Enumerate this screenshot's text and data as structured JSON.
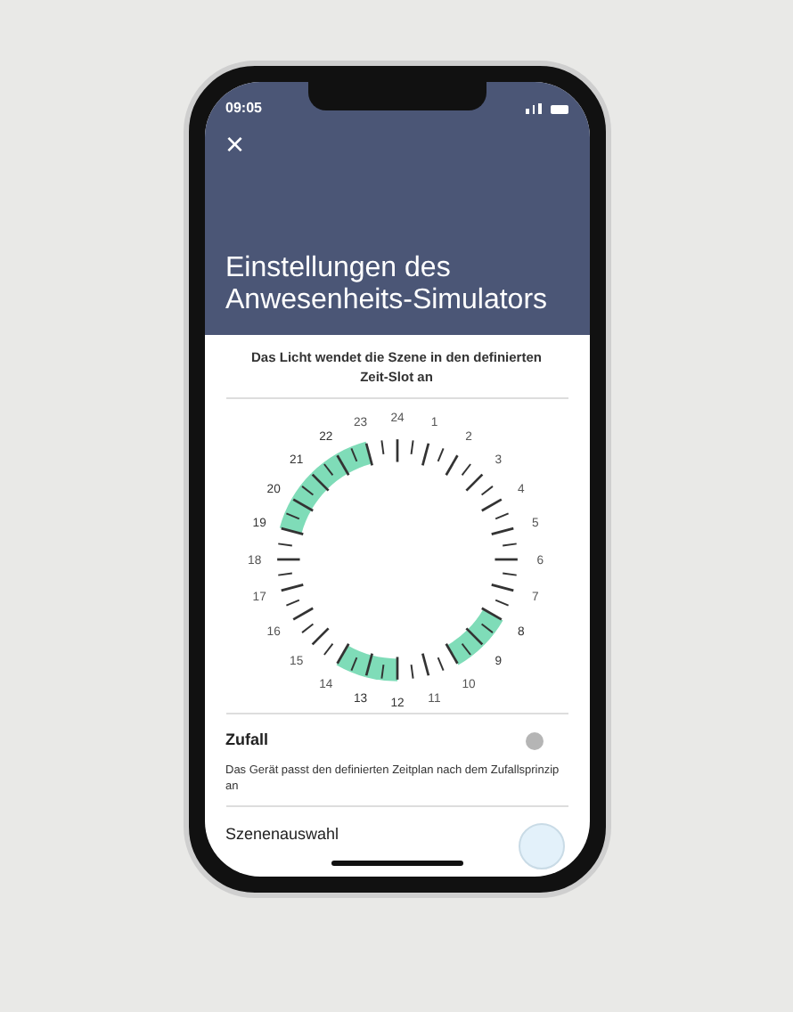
{
  "status_bar": {
    "time": "09:05"
  },
  "header": {
    "close": "×",
    "title": "Einstellungen des Anwesenheits-Simulators"
  },
  "intro": "Das Licht wendet die Szene in den definierten Zeit-Slot an",
  "dial": {
    "right_side": [
      {
        "label": "24",
        "selected": false
      },
      {
        "label": "1",
        "selected": false
      },
      {
        "label": "2",
        "selected": false
      },
      {
        "label": "3",
        "selected": false
      },
      {
        "label": "4",
        "selected": false
      },
      {
        "label": "5",
        "selected": false
      },
      {
        "label": "6",
        "selected": false
      },
      {
        "label": "7",
        "selected": false
      },
      {
        "label": "8",
        "selected": true
      },
      {
        "label": "9",
        "selected": true
      },
      {
        "label": "10",
        "selected": false
      },
      {
        "label": "11",
        "selected": false
      },
      {
        "label": "12",
        "selected": true
      }
    ],
    "left_side": [
      {
        "label": "23",
        "selected": false
      },
      {
        "label": "22",
        "selected": true
      },
      {
        "label": "21",
        "selected": true
      },
      {
        "label": "20",
        "selected": true
      },
      {
        "label": "19",
        "selected": true
      },
      {
        "label": "18",
        "selected": false
      },
      {
        "label": "17",
        "selected": false
      },
      {
        "label": "16",
        "selected": false
      },
      {
        "label": "15",
        "selected": false
      },
      {
        "label": "14",
        "selected": false
      },
      {
        "label": "13",
        "selected": true
      }
    ]
  },
  "random": {
    "label": "Zufall",
    "on": false,
    "description": "Das Gerät passt den definierten Zeitplan nach dem Zufallsprinzip an"
  },
  "scene": {
    "label": "Szenenauswahl"
  }
}
